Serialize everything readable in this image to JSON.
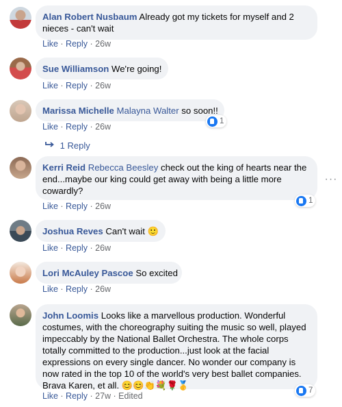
{
  "comments": [
    {
      "author": "Alan Robert Nusbaum",
      "text": "Already got my tickets for myself and 2 nieces - can't wait",
      "like": "Like",
      "reply": "Reply",
      "time": "26w"
    },
    {
      "author": "Sue Williamson",
      "text": "We're going!",
      "like": "Like",
      "reply": "Reply",
      "time": "26w"
    },
    {
      "author": "Marissa Michelle",
      "mention": "Malayna Walter",
      "text": "so soon!!",
      "like": "Like",
      "reply": "Reply",
      "time": "26w",
      "reaction_count": "1",
      "replies_label": "1 Reply"
    },
    {
      "author": "Kerri Reid",
      "mention": "Rebecca Beesley",
      "text": "check out the king of hearts near the end...maybe our king could get away with being a little more cowardly?",
      "like": "Like",
      "reply": "Reply",
      "time": "26w",
      "reaction_count": "1"
    },
    {
      "author": "Joshua Reves",
      "text": "Can't wait 🙂",
      "like": "Like",
      "reply": "Reply",
      "time": "26w"
    },
    {
      "author": "Lori McAuley Pascoe",
      "text": "So excited",
      "like": "Like",
      "reply": "Reply",
      "time": "26w"
    },
    {
      "author": "John Loomis",
      "text": "Looks like a marvellous production. Wonderful costumes, with the choreography suiting the music so well, played impeccably by the National Ballet Orchestra. The whole corps totally committed to the production...just look at the facial expressions on every single dancer. No wonder our company is now rated in the top 10 of the world's very best ballet companies. Brava Karen, et all. 😊😊👏💐🌹🥇",
      "like": "Like",
      "reply": "Reply",
      "time": "27w",
      "edited": "Edited",
      "reaction_count": "7"
    }
  ],
  "separator": " · ",
  "icons": {
    "like": "thumbs-up-icon",
    "reply_arrow": "reply-arrow-icon",
    "more": "more-options-icon"
  },
  "colors": {
    "link": "#385898",
    "bubble": "#f0f2f5",
    "meta": "#65676b",
    "like_blue": "#1877f2"
  }
}
